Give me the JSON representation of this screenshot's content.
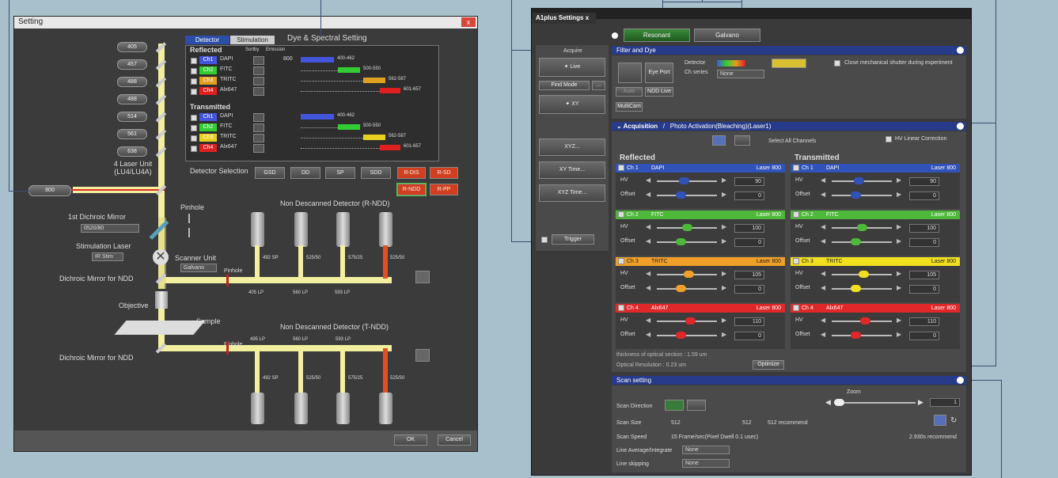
{
  "win1": {
    "title": "Setting",
    "close": "x",
    "laser_buttons": [
      "405",
      "457",
      "488",
      "488",
      "514",
      "561",
      "638"
    ],
    "laser_unit": [
      "4 Laser Unit",
      "(LU4/LU4A)"
    ],
    "laser_800": "800",
    "dichroic1": {
      "label": "1st Dichroic Mirror",
      "value": "0520/80"
    },
    "stim_laser": {
      "label": "Stimulation Laser",
      "value": "IR Stim"
    },
    "pinhole": "Pinhole",
    "scanner_unit": {
      "label": "Scanner Unit",
      "value": "Galvano"
    },
    "dichroic_ndd1": "Dichroic Mirror for NDD",
    "dichroic_ndd2": "Dichroic Mirror for NDD",
    "objective": "Objective",
    "sample": "Sample",
    "ndd_r": "Non Descanned Detector (R-NDD)",
    "ndd_t": "Non Descanned Detector (T-NDD)",
    "pinholes": [
      "Pinhole",
      "Pinhole"
    ],
    "filters_r": [
      "492 SP",
      "525/50",
      "575/25",
      "525/50"
    ],
    "filters_r_bot": [
      "405 LP",
      "560 LP",
      "593 LP"
    ],
    "filters_t_top": [
      "495 LP",
      "560 LP",
      "593 LP"
    ],
    "filters_t": [
      "492 SP",
      "525/50",
      "575/25",
      "525/50"
    ],
    "tabs": [
      "Detector",
      "Stimulation"
    ],
    "dye_title": "Dye & Spectral Setting",
    "reflected": "Reflected",
    "transmitted": "Transmitted",
    "col_sortby": "Sortby",
    "col_emission": "Emission",
    "reflected_rows": [
      {
        "ch": "Ch1",
        "dye": "DAPI",
        "val": "800",
        "range": "400-462",
        "color": "#4455dd"
      },
      {
        "ch": "Ch2",
        "dye": "FITC",
        "range": "500-550",
        "color": "#33cc33"
      },
      {
        "ch": "Ch3",
        "dye": "TRITC",
        "range": "562-587",
        "color": "#e0a020"
      },
      {
        "ch": "Ch4",
        "dye": "Alx647",
        "range": "601-657",
        "color": "#e02020"
      }
    ],
    "transmitted_rows": [
      {
        "ch": "Ch1",
        "dye": "DAPI",
        "range": "400-462",
        "color": "#4455dd"
      },
      {
        "ch": "Ch2",
        "dye": "FITC",
        "range": "500-550",
        "color": "#33cc33"
      },
      {
        "ch": "Ch3",
        "dye": "TRITC",
        "range": "562-587",
        "color": "#e8d020"
      },
      {
        "ch": "Ch4",
        "dye": "Alx647",
        "range": "601-657",
        "color": "#e02020"
      }
    ],
    "detector_selection": "Detector Selection",
    "det_buttons": [
      "GSD",
      "DD",
      "SP",
      "SDD"
    ],
    "det_right": [
      "R-DIS",
      "R-SD",
      "R-NDD",
      "R-PP"
    ],
    "ok": "OK",
    "cancel": "Cancel"
  },
  "win2": {
    "tab": "A1plus Settings",
    "tab_close": "x",
    "mode_buttons": [
      "Resonant",
      "Galvano"
    ],
    "acquire": "Acquire",
    "live": "Live",
    "find_mode": "Find Mode",
    "find_more": "...",
    "xy": "XY",
    "xyz": "XYZ...",
    "xy_time": "XY Time...",
    "xyz_time": "XYZ Time...",
    "trigger": "Trigger",
    "filter_dye": "Filter and Dye",
    "eye_port": "Eye Port",
    "detector": "Detector",
    "ch_series": "Ch series",
    "ch_series_value": "None",
    "close_shutter": "Close mechanical shutter during experiment",
    "auto": "Auto",
    "ndd_live": "NDD Live",
    "multicam": "MultiCam",
    "acquisition": "Acquisition",
    "photo": "Photo Activation(Bleaching)(Laser1)",
    "select_all": "Select All Channels",
    "hv_linear": "HV Linear Correction",
    "reflected": "Reflected",
    "transmitted": "Transmitted",
    "hv": "HV",
    "offset": "Offset",
    "channels": [
      {
        "ch": "Ch 1",
        "dye": "DAPI",
        "laser": "Laser 800",
        "hv": "90",
        "off": "0",
        "color": "#3152b8",
        "text": "#fff",
        "hv_frac": 0.45,
        "off_frac": 0.4
      },
      {
        "ch": "Ch 2",
        "dye": "FITC",
        "laser": "Laser 800",
        "hv": "100",
        "off": "0",
        "color": "#4eb83a",
        "text": "#fff",
        "hv_frac": 0.5,
        "off_frac": 0.4
      },
      {
        "ch": "Ch 3",
        "dye": "TRITC",
        "laser": "Laser 800",
        "hv": "105",
        "off": "0",
        "color": "#f0a028",
        "text": "#222",
        "hv_frac": 0.52,
        "off_frac": 0.4
      },
      {
        "ch": "Ch 4",
        "dye": "Alx647",
        "laser": "Laser 800",
        "hv": "110",
        "off": "0",
        "color": "#e0282a",
        "text": "#fff",
        "hv_frac": 0.55,
        "off_frac": 0.4
      }
    ],
    "channels_t": [
      {
        "ch": "Ch 1",
        "dye": "DAPI",
        "laser": "Laser 800",
        "hv": "90",
        "off": "0",
        "color": "#3152b8",
        "text": "#fff",
        "hv_frac": 0.45,
        "off_frac": 0.4
      },
      {
        "ch": "Ch 2",
        "dye": "FITC",
        "laser": "Laser 800",
        "hv": "100",
        "off": "0",
        "color": "#4eb83a",
        "text": "#fff",
        "hv_frac": 0.5,
        "off_frac": 0.4
      },
      {
        "ch": "Ch 3",
        "dye": "TRITC",
        "laser": "Laser 800",
        "hv": "105",
        "off": "0",
        "color": "#f0e020",
        "text": "#222",
        "hv_frac": 0.52,
        "off_frac": 0.4
      },
      {
        "ch": "Ch 4",
        "dye": "Alx647",
        "laser": "Laser 800",
        "hv": "110",
        "off": "0",
        "color": "#e0282a",
        "text": "#fff",
        "hv_frac": 0.55,
        "off_frac": 0.4
      }
    ],
    "thickness": "thickness of optical section : 1.59 um",
    "resolution": "Optical Resolution : 0.23 um",
    "optimize": "Optimize",
    "scan_setting": "Scan setting",
    "zoom": "Zoom",
    "zoom_value": "1",
    "zoom_frac": 0.05,
    "scan_direction": "Scan Direction",
    "scan_size": "Scan Size",
    "scan_size_val": "512",
    "scan_size_val2": "512",
    "scan_size_rec": "512 recommend",
    "scan_speed": "Scan Speed",
    "scan_speed_val": "15 Frame/sec(Pixel Dwell 0.1 usec)",
    "scan_speed_rec": "2.930s recommend",
    "line_avg": "Line Average/Integrate",
    "line_avg_val": "None",
    "line_skip": "Line skipping",
    "line_skip_val": "None"
  }
}
